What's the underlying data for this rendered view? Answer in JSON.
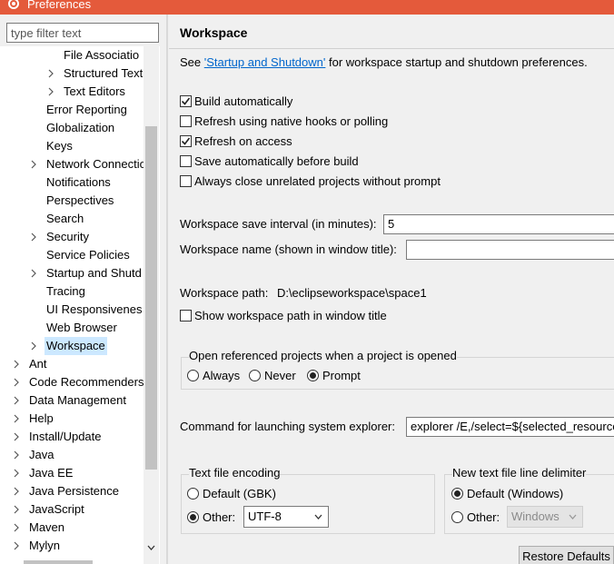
{
  "window": {
    "title": "Preferences"
  },
  "filter": {
    "placeholder": "type filter text"
  },
  "tree": {
    "items": [
      {
        "label": "File Associations",
        "display": "File Associatio",
        "arrow": false
      },
      {
        "label": "Structured Text",
        "display": "Structured Text",
        "arrow": true
      },
      {
        "label": "Text Editors",
        "display": "Text Editors",
        "arrow": true
      },
      {
        "label": "Error Reporting",
        "display": "Error Reporting",
        "arrow": false
      },
      {
        "label": "Globalization",
        "display": "Globalization",
        "arrow": false
      },
      {
        "label": "Keys",
        "display": "Keys",
        "arrow": false
      },
      {
        "label": "Network Connections",
        "display": "Network Connectio",
        "arrow": true
      },
      {
        "label": "Notifications",
        "display": "Notifications",
        "arrow": false
      },
      {
        "label": "Perspectives",
        "display": "Perspectives",
        "arrow": false
      },
      {
        "label": "Search",
        "display": "Search",
        "arrow": false
      },
      {
        "label": "Security",
        "display": "Security",
        "arrow": true
      },
      {
        "label": "Service Policies",
        "display": "Service Policies",
        "arrow": false
      },
      {
        "label": "Startup and Shutdown",
        "display": "Startup and Shutd",
        "arrow": true
      },
      {
        "label": "Tracing",
        "display": "Tracing",
        "arrow": false
      },
      {
        "label": "UI Responsiveness",
        "display": "UI Responsivenes",
        "arrow": false
      },
      {
        "label": "Web Browser",
        "display": "Web Browser",
        "arrow": false
      },
      {
        "label": "Workspace",
        "display": "Workspace",
        "arrow": true,
        "selected": true
      },
      {
        "label": "Ant",
        "display": "Ant",
        "arrow": true
      },
      {
        "label": "Code Recommenders",
        "display": "Code Recommenders",
        "arrow": true
      },
      {
        "label": "Data Management",
        "display": "Data Management",
        "arrow": true
      },
      {
        "label": "Help",
        "display": "Help",
        "arrow": true
      },
      {
        "label": "Install/Update",
        "display": "Install/Update",
        "arrow": true
      },
      {
        "label": "Java",
        "display": "Java",
        "arrow": true
      },
      {
        "label": "Java EE",
        "display": "Java EE",
        "arrow": true
      },
      {
        "label": "Java Persistence",
        "display": "Java Persistence",
        "arrow": true
      },
      {
        "label": "JavaScript",
        "display": "JavaScript",
        "arrow": true
      },
      {
        "label": "Maven",
        "display": "Maven",
        "arrow": true
      },
      {
        "label": "Mylyn",
        "display": "Mylyn",
        "arrow": true
      }
    ]
  },
  "page": {
    "title": "Workspace",
    "see_prefix": "See ",
    "see_link": "'Startup and Shutdown'",
    "see_suffix": " for workspace startup and shutdown preferences.",
    "options": [
      {
        "label": "Build automatically",
        "checked": true
      },
      {
        "label": "Refresh using native hooks or polling",
        "checked": false
      },
      {
        "label": "Refresh on access",
        "checked": true
      },
      {
        "label": "Save automatically before build",
        "checked": false
      },
      {
        "label": "Always close unrelated projects without prompt",
        "checked": false
      }
    ],
    "save_interval_label": "Workspace save interval (in minutes):",
    "save_interval_value": "5",
    "name_label": "Workspace name (shown in window title):",
    "name_value": "",
    "path_label": "Workspace path:",
    "path_value": "D:\\eclipseworkspace\\space1",
    "show_path_label": "Show workspace path in window title",
    "show_path_checked": false,
    "open_ref": {
      "label": "Open referenced projects when a project is opened",
      "options": [
        "Always",
        "Never",
        "Prompt"
      ],
      "selected": "Prompt"
    },
    "explorer_label": "Command for launching system explorer:",
    "explorer_value": "explorer /E,/select=${selected_resource_loc}",
    "encoding": {
      "label": "Text file encoding",
      "default_label": "Default (GBK)",
      "other_label": "Other:",
      "selected": "Other",
      "other_value": "UTF-8"
    },
    "delimiter": {
      "label": "New text file line delimiter",
      "default_label": "Default (Windows)",
      "other_label": "Other:",
      "selected": "Default",
      "other_value": "Windows"
    },
    "restore_button": "Restore Defaults"
  }
}
